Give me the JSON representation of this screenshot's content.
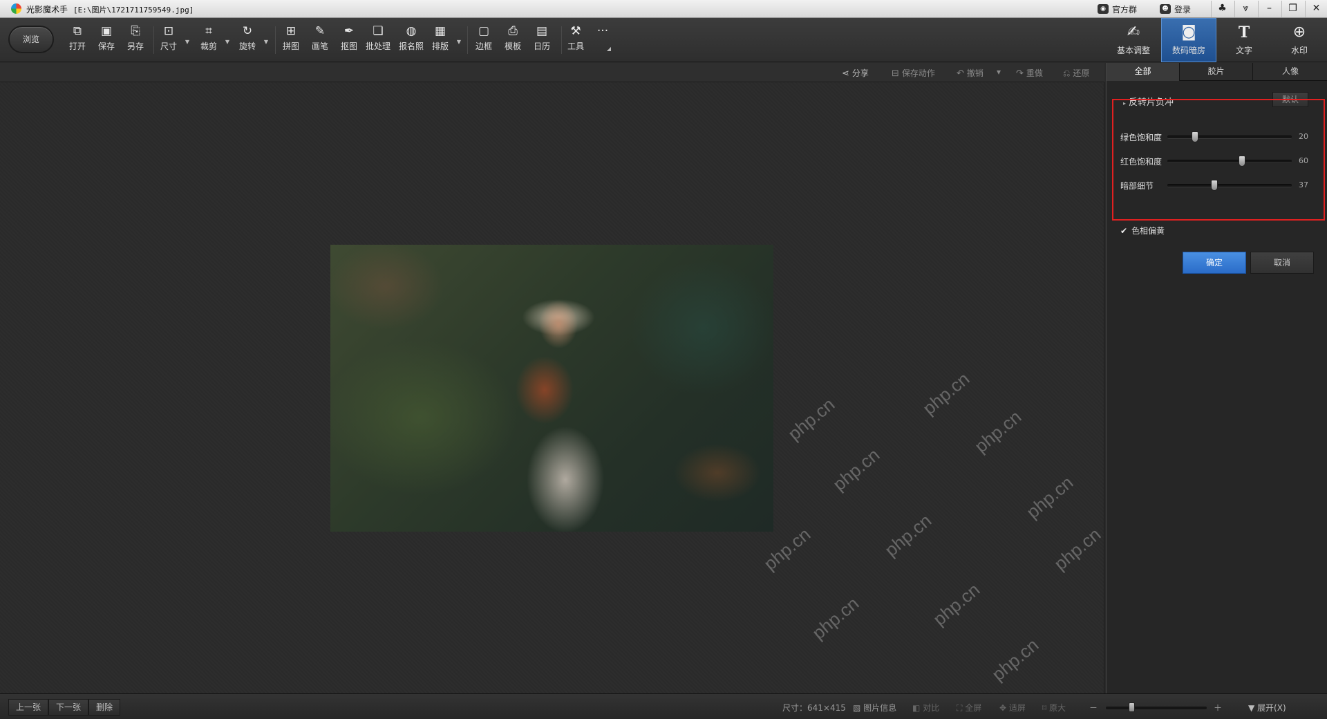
{
  "window": {
    "app_name": "光影魔术手",
    "file_path": "[E:\\图片\\1721711759549.jpg]",
    "group_label": "官方群",
    "login_label": "登录"
  },
  "toolbar": {
    "browse": "浏览",
    "tools": [
      "打开",
      "保存",
      "另存",
      "尺寸",
      "裁剪",
      "旋转",
      "拼图",
      "画笔",
      "抠图",
      "批处理",
      "报名照",
      "排版",
      "边框",
      "模板",
      "日历",
      "工具"
    ],
    "more": "···"
  },
  "modes": [
    "基本调整",
    "数码暗房",
    "文字",
    "水印"
  ],
  "actions": {
    "share": "分享",
    "save_action": "保存动作",
    "undo": "撤销",
    "redo": "重做",
    "restore": "还原"
  },
  "panel": {
    "tabs": [
      "全部",
      "胶片",
      "人像"
    ],
    "effect_title": "反转片负冲",
    "default_btn": "默认",
    "sliders": [
      {
        "label": "绿色饱和度",
        "value": 20,
        "percent": 0.22
      },
      {
        "label": "红色饱和度",
        "value": 60,
        "percent": 0.6
      },
      {
        "label": "暗部细节",
        "value": 37,
        "percent": 0.38
      }
    ],
    "hue_label": "色相偏黄",
    "hue_checked": true,
    "ok": "确定",
    "cancel": "取消"
  },
  "watermark_text": "php.cn",
  "status": {
    "prev": "上一张",
    "next": "下一张",
    "delete": "删除",
    "size_label": "尺寸：641×415",
    "info": "图片信息",
    "compare": "对比",
    "fullscreen": "全屏",
    "fit": "适屏",
    "actual": "原大",
    "zoom_minus": "－",
    "zoom_plus": "＋",
    "zoom_percent": 0.25,
    "expand": "展开(X)"
  },
  "colors": {
    "accent": "#2a6cc8",
    "highlight_box": "#e02020"
  }
}
